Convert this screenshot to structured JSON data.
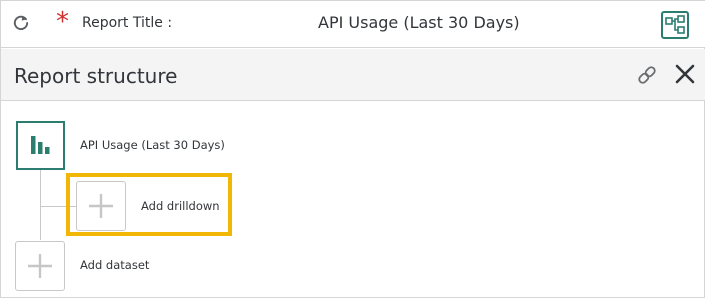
{
  "header": {
    "required_marker": "*",
    "report_title_label": "Report Title :",
    "report_title_value": "API Usage (Last 30 Days)",
    "icons": {
      "refresh": "refresh-icon",
      "structure": "hierarchy-icon"
    }
  },
  "panel": {
    "title": "Report structure",
    "icons": {
      "link": "link-icon",
      "close": "close-icon"
    }
  },
  "tree": {
    "report_node": {
      "label": "API Usage (Last 30 Days)",
      "icon": "bar-chart-icon"
    },
    "drilldown_node": {
      "label": "Add drilldown",
      "icon": "plus-icon"
    },
    "dataset_node": {
      "label": "Add dataset",
      "icon": "plus-icon"
    }
  },
  "colors": {
    "accent": "#2b7d6f",
    "required": "#d0312d",
    "highlight": "#f2b705",
    "border": "#d5d5d5",
    "text": "#32363a"
  }
}
